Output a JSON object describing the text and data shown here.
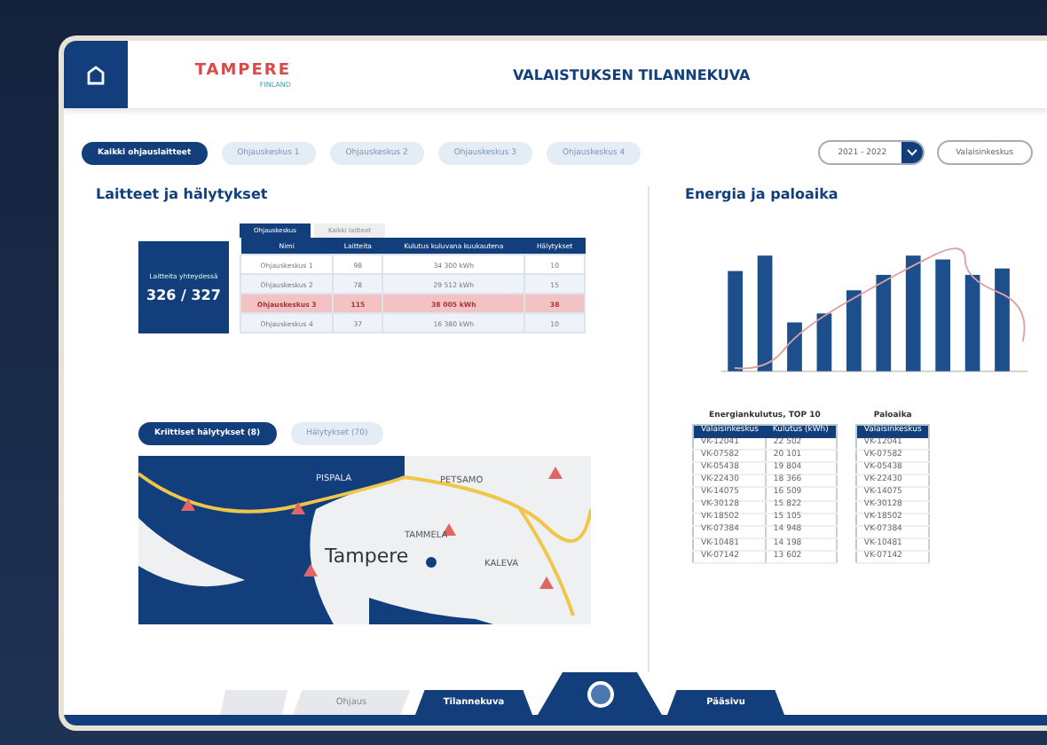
{
  "header": {
    "logo": "TAMPERE",
    "logo_sub": "FINLAND",
    "title": "VALAISTUKSEN TILANNEKUVA"
  },
  "filters": [
    {
      "label": "Kaikki ohjauslaitteet",
      "selected": true
    },
    {
      "label": "Ohjauskeskus 1",
      "selected": false
    },
    {
      "label": "Ohjauskeskus 2",
      "selected": false
    },
    {
      "label": "Ohjauskeskus 3",
      "selected": false
    },
    {
      "label": "Ohjauskeskus 4",
      "selected": false
    }
  ],
  "period": {
    "value": "2021 - 2022"
  },
  "view_button": "Valaisinkeskus",
  "devices": {
    "title": "Laitteet ja hälytykset",
    "card_label": "Laitteita yhteydessä",
    "card_value": "326 / 327",
    "tabs": [
      {
        "label": "Ohjauskeskus",
        "selected": true
      },
      {
        "label": "Kaikki laitteet",
        "selected": false
      }
    ],
    "columns": [
      "Nimi",
      "Laitteita",
      "Kulutus kuluvana kuukautena",
      "Hälytykset"
    ],
    "rows": [
      {
        "cells": [
          "Ohjauskeskus 1",
          "98",
          "34 300 kWh",
          "10"
        ],
        "alert": false
      },
      {
        "cells": [
          "Ohjauskeskus 2",
          "78",
          "29 512 kWh",
          "15"
        ],
        "alert": false
      },
      {
        "cells": [
          "Ohjauskeskus 3",
          "115",
          "38 005 kWh",
          "38"
        ],
        "alert": true
      },
      {
        "cells": [
          "Ohjauskeskus 4",
          "37",
          "16 380 kWh",
          "10"
        ],
        "alert": false
      }
    ],
    "alarm_tabs": [
      {
        "label": "Kriittiset hälytykset (8)",
        "selected": true
      },
      {
        "label": "Hälytykset (70)",
        "selected": false
      }
    ],
    "map_labels": [
      "PISPALA",
      "Tampere",
      "TAMMELA",
      "PETSAMO",
      "KALEVA"
    ]
  },
  "energy": {
    "title": "Energia ja paloaika",
    "tables": [
      {
        "title": "Energiankulutus, TOP 10",
        "columns": [
          "Valaisinkeskus",
          "Kulutus (kWh)"
        ],
        "rows": [
          [
            "VK-12041",
            "22 502"
          ],
          [
            "VK-07582",
            "20 101"
          ],
          [
            "VK-05438",
            "19 804"
          ],
          [
            "VK-22430",
            "18 366"
          ],
          [
            "VK-14075",
            "16 509"
          ],
          [
            "VK-30128",
            "15 822"
          ],
          [
            "VK-18502",
            "15 105"
          ],
          [
            "VK-07384",
            "14 948"
          ],
          [
            "VK-10481",
            "14 198"
          ],
          [
            "VK-07142",
            "13 602"
          ]
        ]
      },
      {
        "title": "Paloaika",
        "columns": [
          "Valaisinkeskus"
        ],
        "rows": [
          [
            "VK-12041"
          ],
          [
            "VK-07582"
          ],
          [
            "VK-05438"
          ],
          [
            "VK-22430"
          ],
          [
            "VK-14075"
          ],
          [
            "VK-30128"
          ],
          [
            "VK-18502"
          ],
          [
            "VK-07384"
          ],
          [
            "VK-10481"
          ],
          [
            "VK-07142"
          ]
        ]
      }
    ]
  },
  "nav": [
    {
      "label": "Ohjaus",
      "active": false
    },
    {
      "label": "Tilannekuva",
      "active": true
    },
    {
      "label": "Pääsivu",
      "active": true
    }
  ]
}
